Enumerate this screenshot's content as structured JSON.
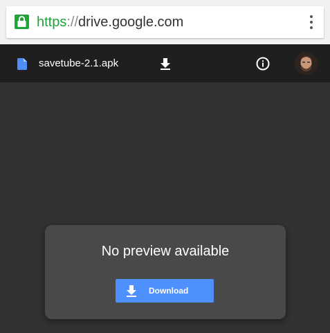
{
  "browser": {
    "url_scheme": "https",
    "url_separator": "://",
    "url_host": "drive.google.com",
    "lock_icon": "lock-icon",
    "menu_icon": "more-vert-icon",
    "secure_color": "#1fa33a"
  },
  "toolbar": {
    "file_icon": "document-icon",
    "file_name": "savetube-2.1.apk",
    "download_icon": "download-icon",
    "info_icon": "info-icon",
    "avatar": "user-avatar"
  },
  "preview": {
    "message": "No preview available",
    "download_label": "Download",
    "button_color": "#4d90fe"
  }
}
